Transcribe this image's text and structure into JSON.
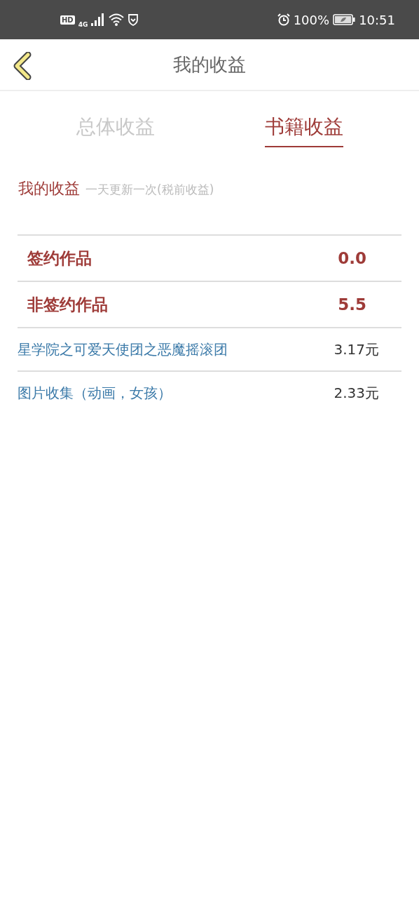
{
  "status_bar": {
    "hd": "HD",
    "network": "4G",
    "battery": "100%",
    "time": "10:51"
  },
  "header": {
    "title": "我的收益"
  },
  "tabs": [
    {
      "label": "总体收益",
      "selected": false
    },
    {
      "label": "书籍收益",
      "selected": true
    }
  ],
  "section": {
    "title": "我的收益",
    "note": "一天更新一次(税前收益)"
  },
  "rows": [
    {
      "kind": "category",
      "label": "签约作品",
      "amount": "0.0"
    },
    {
      "kind": "category",
      "label": "非签约作品",
      "amount": "5.5"
    },
    {
      "kind": "book",
      "label": "星学院之可爱天使团之恶魔摇滚团",
      "amount": "3.17元"
    },
    {
      "kind": "book",
      "label": "图片收集（动画，女孩）",
      "amount": "2.33元"
    }
  ]
}
